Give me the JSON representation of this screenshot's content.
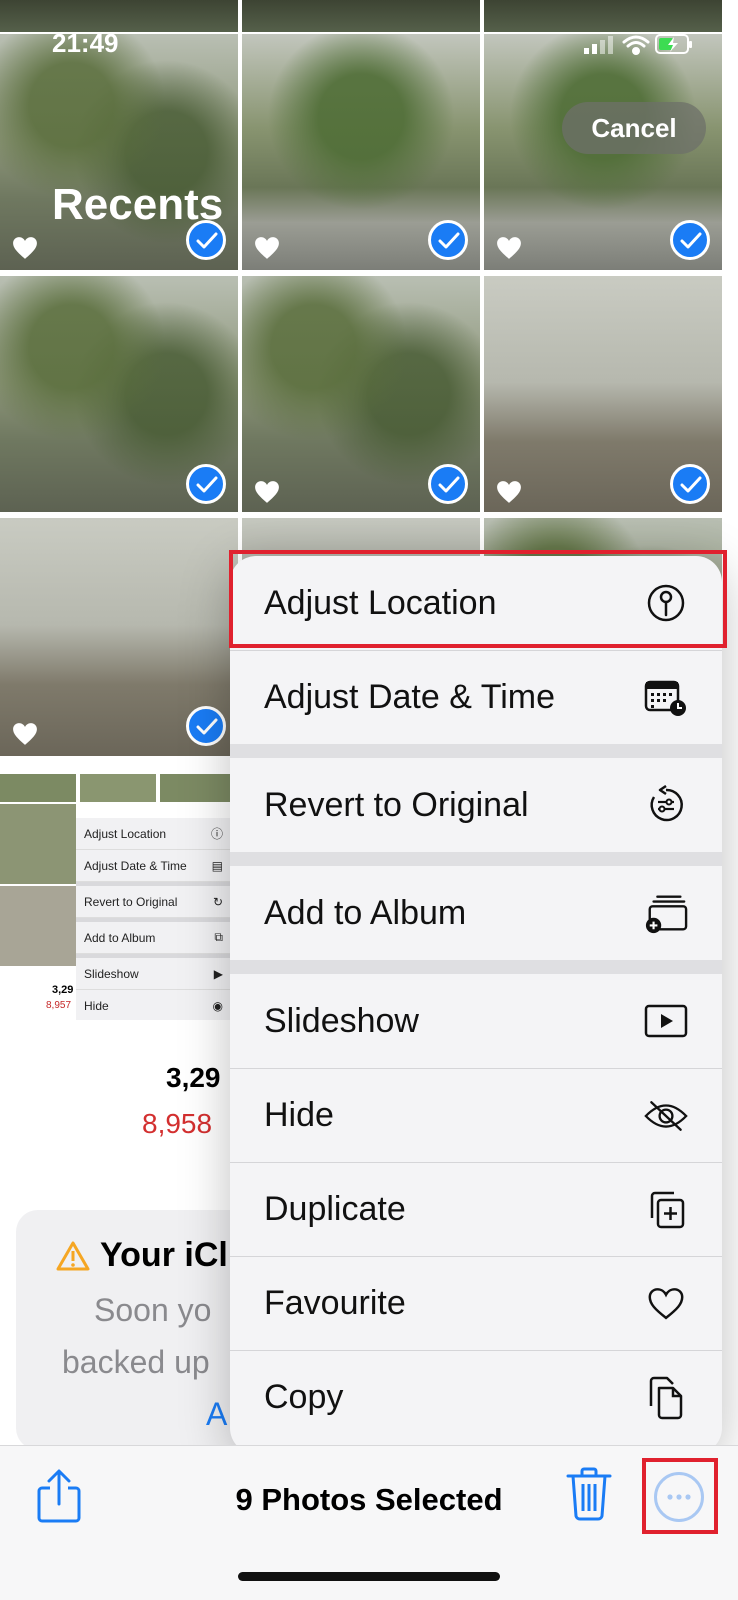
{
  "status_bar": {
    "time": "21:49"
  },
  "header": {
    "title": "Recents",
    "cancel_label": "Cancel"
  },
  "library": {
    "count_primary": "3,29",
    "count_secondary": "8,958"
  },
  "icloud_card": {
    "title": "Your iCl",
    "line1": "Soon yo",
    "line2": "backed up",
    "link": "A"
  },
  "mini_preview": {
    "items": [
      "Adjust Location",
      "Adjust Date & Time",
      "Revert to Original",
      "Add to Album",
      "Slideshow",
      "Hide"
    ],
    "count_primary": "3,29",
    "count_secondary": "8,957"
  },
  "context_menu": {
    "groups": [
      {
        "items": [
          {
            "label": "Adjust Location",
            "icon": "location-pin-icon"
          },
          {
            "label": "Adjust Date & Time",
            "icon": "calendar-clock-icon"
          }
        ]
      },
      {
        "items": [
          {
            "label": "Revert to Original",
            "icon": "revert-icon"
          }
        ]
      },
      {
        "items": [
          {
            "label": "Add to Album",
            "icon": "add-to-album-icon"
          }
        ]
      },
      {
        "items": [
          {
            "label": "Slideshow",
            "icon": "slideshow-icon"
          },
          {
            "label": "Hide",
            "icon": "hide-eye-icon"
          },
          {
            "label": "Duplicate",
            "icon": "duplicate-icon"
          },
          {
            "label": "Favourite",
            "icon": "heart-icon"
          },
          {
            "label": "Copy",
            "icon": "copy-icon"
          }
        ]
      }
    ]
  },
  "toolbar": {
    "selected_label": "9 Photos Selected"
  },
  "colors": {
    "accent": "#1a7cf5",
    "highlight": "#e0212e",
    "warning": "#f5a623",
    "danger_text": "#d32f2f"
  }
}
